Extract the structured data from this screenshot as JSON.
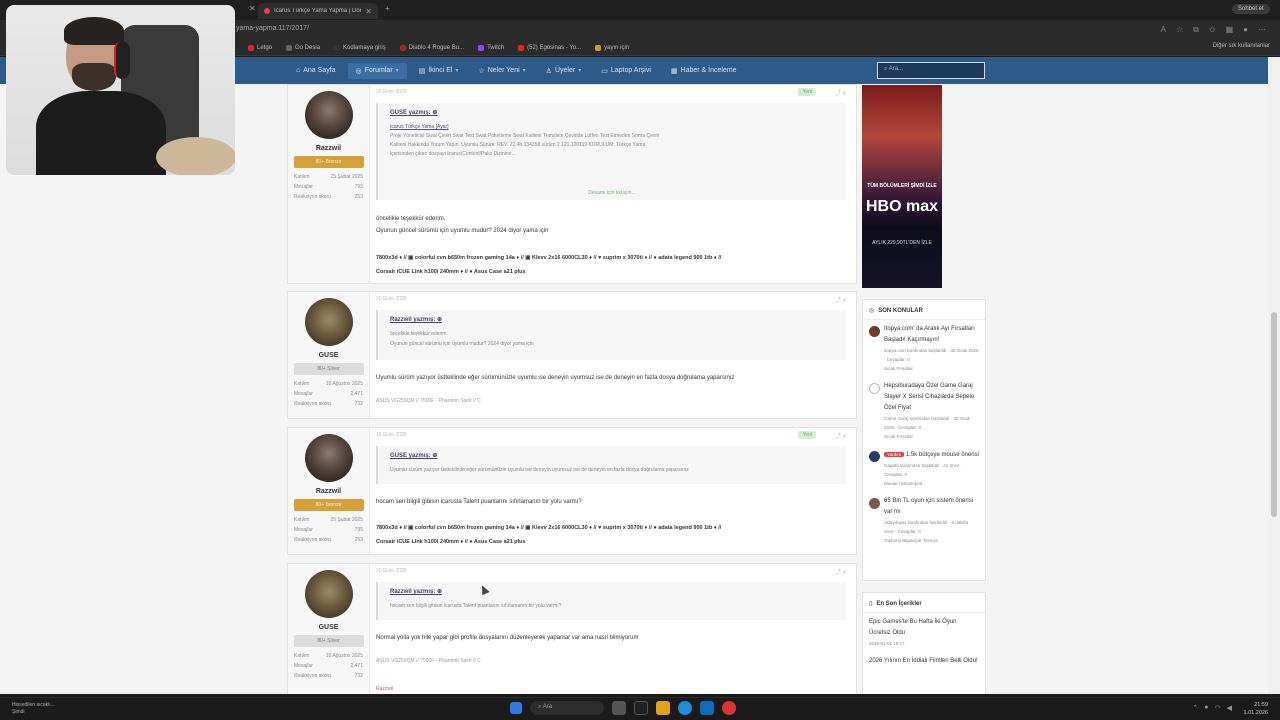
{
  "browser": {
    "tab_title": "Icarus Türkçe Yama Yapma | Donan...",
    "url": "yama-yapma.117/2017/",
    "profile_label": "Sohbet et",
    "bookmarks": [
      "Letgo",
      "Go Desia",
      "Kodlamaya giriş",
      "Diablo 4 Rogue Bu...",
      "Twitch",
      "(52) Egosinas - Yo...",
      "yayın için"
    ],
    "bookmarks_right": "Diğer sık kullanılanlar"
  },
  "nav": {
    "items": [
      "Ana Sayfa",
      "Forumlar",
      "İkinci El",
      "Neler Yeni",
      "Üyeler",
      "Laptop Arşivi",
      "Haber & İnceleme"
    ],
    "search_placeholder": "Ara..."
  },
  "posts": [
    {
      "user": "Razzwil",
      "badge": "80+ Bronze",
      "stats": [
        [
          "Katılım",
          "25 Şubat 2025"
        ],
        [
          "Mesajlar",
          "795"
        ],
        [
          "Reaksiyon skoru",
          "253"
        ]
      ],
      "date": "20 Ekim 2025",
      "new_tag": "Yeni",
      "quote_author": "GUSE yazmış: ⊕",
      "quote_lines": [
        "Icarus Türkçe Yama [Ayar]",
        "Proje Yöneticisi Swat Çeviri Swat Test Swat Paketleme Swat Kalitesi Translate Çeviride Lütfen Test Etmeden Sonra Çeviri",
        "Kaliteni Hakkında Yorum Yapın. Uyumlu Sürüm: REV. 22.4b.134358 sürüm 2.121.120119 KURULUM: Türkçe Yama",
        "içerisinden çıkan dosyayı Icarus/Content/Paks Dizinine..."
      ],
      "quote_expand": "Devamı için tıklayın...",
      "body": [
        "öncelikle teşekkür ederim.",
        "Oyunun güncel sürümü için uyumlu mudur? 2024 diyor yama için"
      ],
      "signature": [
        "7800x3d ♦ // ▣ colorful cvn b650m frozen gaming 14a ♦ // ▣ Klevv 2x16 6000CL30 ♦ // ♥ suprim x 3070ti ♦ // ● adata legend 900 1tb ♦ //",
        "Corsair iCUE Link h100i 240mm ♦ // ● Asus Case a21 plus"
      ]
    },
    {
      "user": "GUSE",
      "badge": "80+ Silver",
      "stats": [
        [
          "Katılım",
          "19 Ağustos 2025"
        ],
        [
          "Mesajlar",
          "2,471"
        ],
        [
          "Reaksiyon skoru",
          "732"
        ]
      ],
      "date": "20 Ekim 2025",
      "quote_author": "Razzwil yazmış: ⊕",
      "quote_lines": [
        "öncelikle teşekkür ederim.",
        "Oyunun güncel sürümü için uyumlu mudur? 2024 diyor yama için"
      ],
      "body": [
        "Uyumlu sürüm yazıyor üstteklinde eğer sürümünüzle uyumlu ise deneyin uyumsuz ise de deneyin en fazla dosya doğrulama yaparsınız"
      ],
      "signature_plain": "ASUS VG259QM // 7500F - Phantom Spirit // C"
    },
    {
      "user": "Razzwil",
      "badge": "80+ Bronze",
      "stats": [
        [
          "Katılım",
          "25 Şubat 2025"
        ],
        [
          "Mesajlar",
          "795"
        ],
        [
          "Reaksiyon skoru",
          "253"
        ]
      ],
      "date": "16 Ekim 2025",
      "new_tag": "Yeni",
      "quote_author": "GUSE yazmış: ⊕",
      "quote_lines": [
        "Uyumlu sürüm yazıyor üstteklinde eğer sürümünüzle uyumlu ise deneyin uyumsuz ise de deneyin en fazla dosya doğrulama yaparsınız"
      ],
      "body": [
        "hocam sen bilgili gibisin icarusta Talent puanlarını sıfırlamanın bir yolu varmı?"
      ],
      "signature": [
        "7800x3d ♦ // ▣ colorful cvn b650m frozen gaming 14a ♦ // ▣ Klevv 2x16 6000CL30 ♦ // ♥ suprim x 3070ti ♦ // ● adata legend 900 1tb ♦ //",
        "Corsair iCUE Link h100i 240mm ♦ // ● Asus Case a21 plus"
      ]
    },
    {
      "user": "GUSE",
      "badge": "80+ Silver",
      "stats": [
        [
          "Katılım",
          "19 Ağustos 2025"
        ],
        [
          "Mesajlar",
          "2,471"
        ],
        [
          "Reaksiyon skoru",
          "732"
        ]
      ],
      "date": "20 Ekim 2025",
      "quote_author": "Razzwil yazmış: ⊕",
      "quote_lines": [
        "hocam sen bilgili gibisin icarusta Talent puanlarını sıfırlamanın bir yolu varmı?"
      ],
      "body": [
        "Normal yolla yok hile yapar gibi profile dosyalarını düzenleyerek yapanlar var ama nasıl bilmiyorum"
      ],
      "signature_plain": "ASUS VG259QM // 7500F - Phantom Spirit // C",
      "next_user": "Razzwil"
    }
  ],
  "ad": {
    "caption": "TÜM BÖLÜMLERİ ŞİMDİ İZLE",
    "brand": "HBO max",
    "price": "AYLIK 229,90TL'DEN İZLE"
  },
  "sidebar": {
    "latest_title": "SON KONULAR",
    "latest": [
      {
        "title": "Itopya.com' da Aralık Ayı Fırsatları Başladı! Kaçırmayın!",
        "meta": "itopya.com tarafından başlatıldı · 30 Ocak 2026 · Cevaplar: 0",
        "forum": "Sıcak Fırsatlar"
      },
      {
        "title": "Hepsiburadaya Özel Game Garaj Slayer X Serisi Cihazlarda Sepete Özel Fiyat",
        "meta": "Game Garaj tarafından başlatıldı · 30 Ocak 2026 · Cevaplar: 0",
        "forum": "Sıcak Fırsatlar"
      },
      {
        "tag": "Yardım",
        "title": "1.5k bütçeye mouse önerisi",
        "meta": "Gagafa tarafından başlatıldı · Az önce · Cevaplar: 0",
        "forum": "Mouse / Mousepad"
      },
      {
        "title": "65 Bin TL oyun için sistem önerisi var mı",
        "meta": "oktaydayaz tarafından başlatıldı · 6 dakika önce · Cevaplar: 0",
        "forum": "Toplama Bilgisayar Tavsiye"
      }
    ],
    "content_title": "En Son İçerikler",
    "content": [
      {
        "title": "Epic Games'te Bu Hafta İki Oyun Ücretsiz Oldu",
        "meta": "2026-01-01 19:17"
      },
      {
        "title": "2026 Yılının En İddialı Filmleri Belli Oldu!",
        "meta": ""
      }
    ]
  },
  "taskbar": {
    "weather_line1": "Hissedilen sıcaklı...",
    "weather_line2": "Şimdi",
    "search": "Ara",
    "time": "21:59",
    "date": "1.01.2026"
  }
}
